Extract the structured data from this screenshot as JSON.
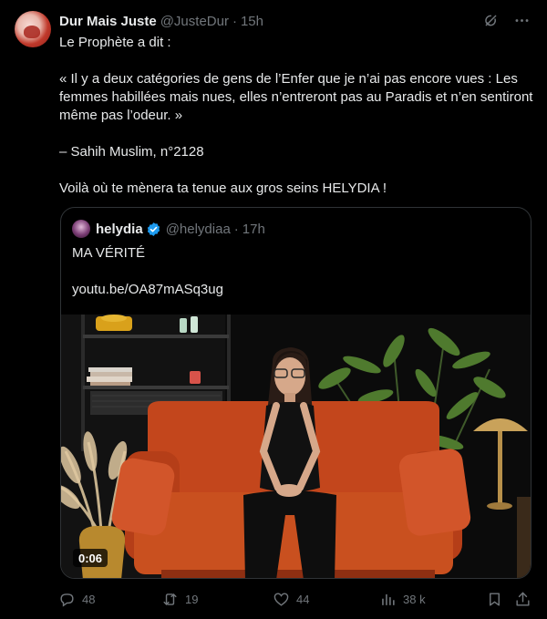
{
  "author": {
    "name": "Dur Mais Juste",
    "handle": "@JusteDur",
    "separator": "·",
    "time": "15h"
  },
  "body": {
    "lines": [
      "Le Prophète a dit :",
      "« Il y a deux catégories de gens de l’Enfer que je n’ai pas encore vues : Les femmes habillées mais nues, elles n’entreront pas au Paradis et n’en sentiront même pas l’odeur. »",
      "– Sahih Muslim, n°2128",
      "Voilà où te mènera ta tenue aux gros seins HELYDIA !"
    ]
  },
  "header_icons": [
    "grok-icon",
    "more-icon"
  ],
  "quote": {
    "name": "helydia",
    "verified": true,
    "handle": "@helydiaa",
    "separator": "·",
    "time": "17h",
    "text": "MA VÉRITÉ",
    "link": "youtu.be/OA87mASq3ug",
    "video_duration": "0:06"
  },
  "actions": {
    "replies": "48",
    "reposts": "19",
    "likes": "44",
    "views": "38 k"
  },
  "colors": {
    "background": "#000000",
    "text": "#e7e9ea",
    "muted": "#71767b",
    "border": "#2f3336",
    "verified": "#1d9bf0",
    "sofa": "#c3461c"
  }
}
